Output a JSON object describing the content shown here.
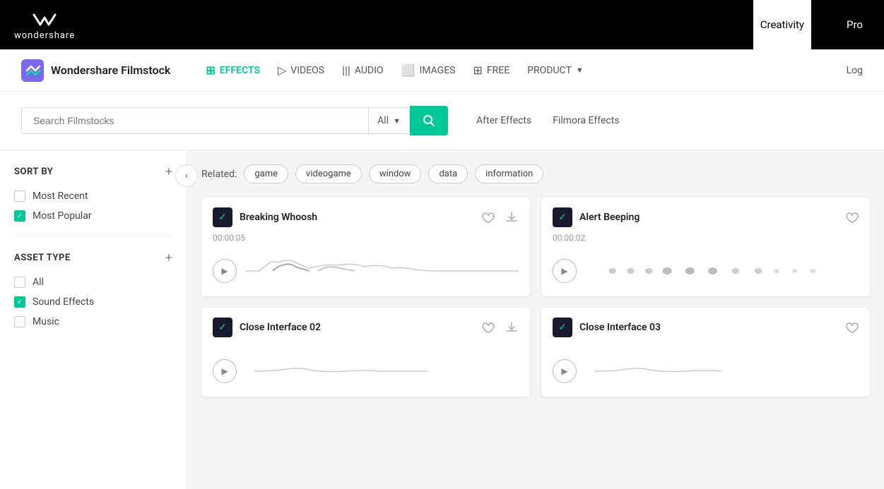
{
  "topNav": {
    "logo_text": "wondershare",
    "links": [
      {
        "label": "Creativity",
        "active": true
      },
      {
        "label": "Pro",
        "active": false
      }
    ]
  },
  "mainNav": {
    "brand": "Wondershare Filmstock",
    "items": [
      {
        "id": "effects",
        "label": "EFFECTS",
        "icon": "▣",
        "active": true
      },
      {
        "id": "videos",
        "label": "VIDEOS",
        "icon": "▷",
        "active": false
      },
      {
        "id": "audio",
        "label": "AUDIO",
        "icon": "|||",
        "active": false
      },
      {
        "id": "images",
        "label": "IMAGES",
        "icon": "⬜",
        "active": false
      },
      {
        "id": "free",
        "label": "FREE",
        "icon": "⊞",
        "active": false
      },
      {
        "id": "product",
        "label": "PRODUCT",
        "icon": "",
        "active": false
      }
    ],
    "login": "Log"
  },
  "searchBar": {
    "placeholder": "Search Filmstocks",
    "dropdown_value": "All",
    "filters": [
      {
        "label": "After Effects",
        "active": false
      },
      {
        "label": "Filmora Effects",
        "active": false
      }
    ]
  },
  "sidebar": {
    "sort_by_title": "SORT BY",
    "sort_options": [
      {
        "label": "Most Recent",
        "checked": false
      },
      {
        "label": "Most Popular",
        "checked": true
      }
    ],
    "asset_type_title": "ASSET TYPE",
    "asset_options": [
      {
        "label": "All",
        "checked": false
      },
      {
        "label": "Sound Effects",
        "checked": true
      },
      {
        "label": "Music",
        "checked": false
      }
    ]
  },
  "related": {
    "label": "Related:",
    "tags": [
      "game",
      "videogame",
      "window",
      "data",
      "information"
    ]
  },
  "cards": [
    {
      "title": "Breaking Whoosh",
      "time": "00:00:05",
      "waveform_type": "wave1"
    },
    {
      "title": "Alert Beeping",
      "time": "00:00:02",
      "waveform_type": "wave2"
    },
    {
      "title": "Close Interface 02",
      "time": "",
      "waveform_type": "wave3"
    },
    {
      "title": "Close Interface 03",
      "time": "",
      "waveform_type": "wave4"
    }
  ]
}
